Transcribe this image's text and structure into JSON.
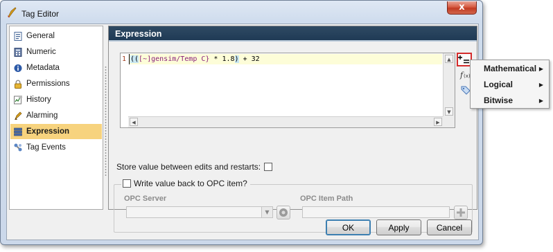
{
  "window": {
    "title": "Tag Editor",
    "close_glyph": "x"
  },
  "sidebar": {
    "items": [
      {
        "label": "General",
        "icon": "general-icon"
      },
      {
        "label": "Numeric",
        "icon": "numeric-icon"
      },
      {
        "label": "Metadata",
        "icon": "metadata-icon"
      },
      {
        "label": "Permissions",
        "icon": "lock-icon"
      },
      {
        "label": "History",
        "icon": "history-icon"
      },
      {
        "label": "Alarming",
        "icon": "alarm-bell-icon"
      },
      {
        "label": "Expression",
        "icon": "expression-icon",
        "active": true
      },
      {
        "label": "Tag Events",
        "icon": "tag-events-icon"
      }
    ]
  },
  "main": {
    "header": "Expression",
    "editor": {
      "line_number": "1",
      "code_open": "((",
      "code_tag": "[~]gensim/Temp C}",
      "code_mid": " * 1.8",
      "code_close": ")",
      "code_end": " + 32"
    },
    "store_label": "Store value between edits and restarts:",
    "write_back_label": "Write value back to OPC item?",
    "opc_server_label": "OPC Server",
    "opc_item_path_label": "OPC Item Path"
  },
  "buttons": {
    "ok": "OK",
    "apply": "Apply",
    "cancel": "Cancel"
  },
  "popup_menu": {
    "items": [
      "Mathematical",
      "Logical",
      "Bitwise"
    ]
  },
  "colors": {
    "active_nav": "#f7d37e",
    "header_bg": "#1f3a55",
    "highlight_border": "#d42b2b"
  }
}
